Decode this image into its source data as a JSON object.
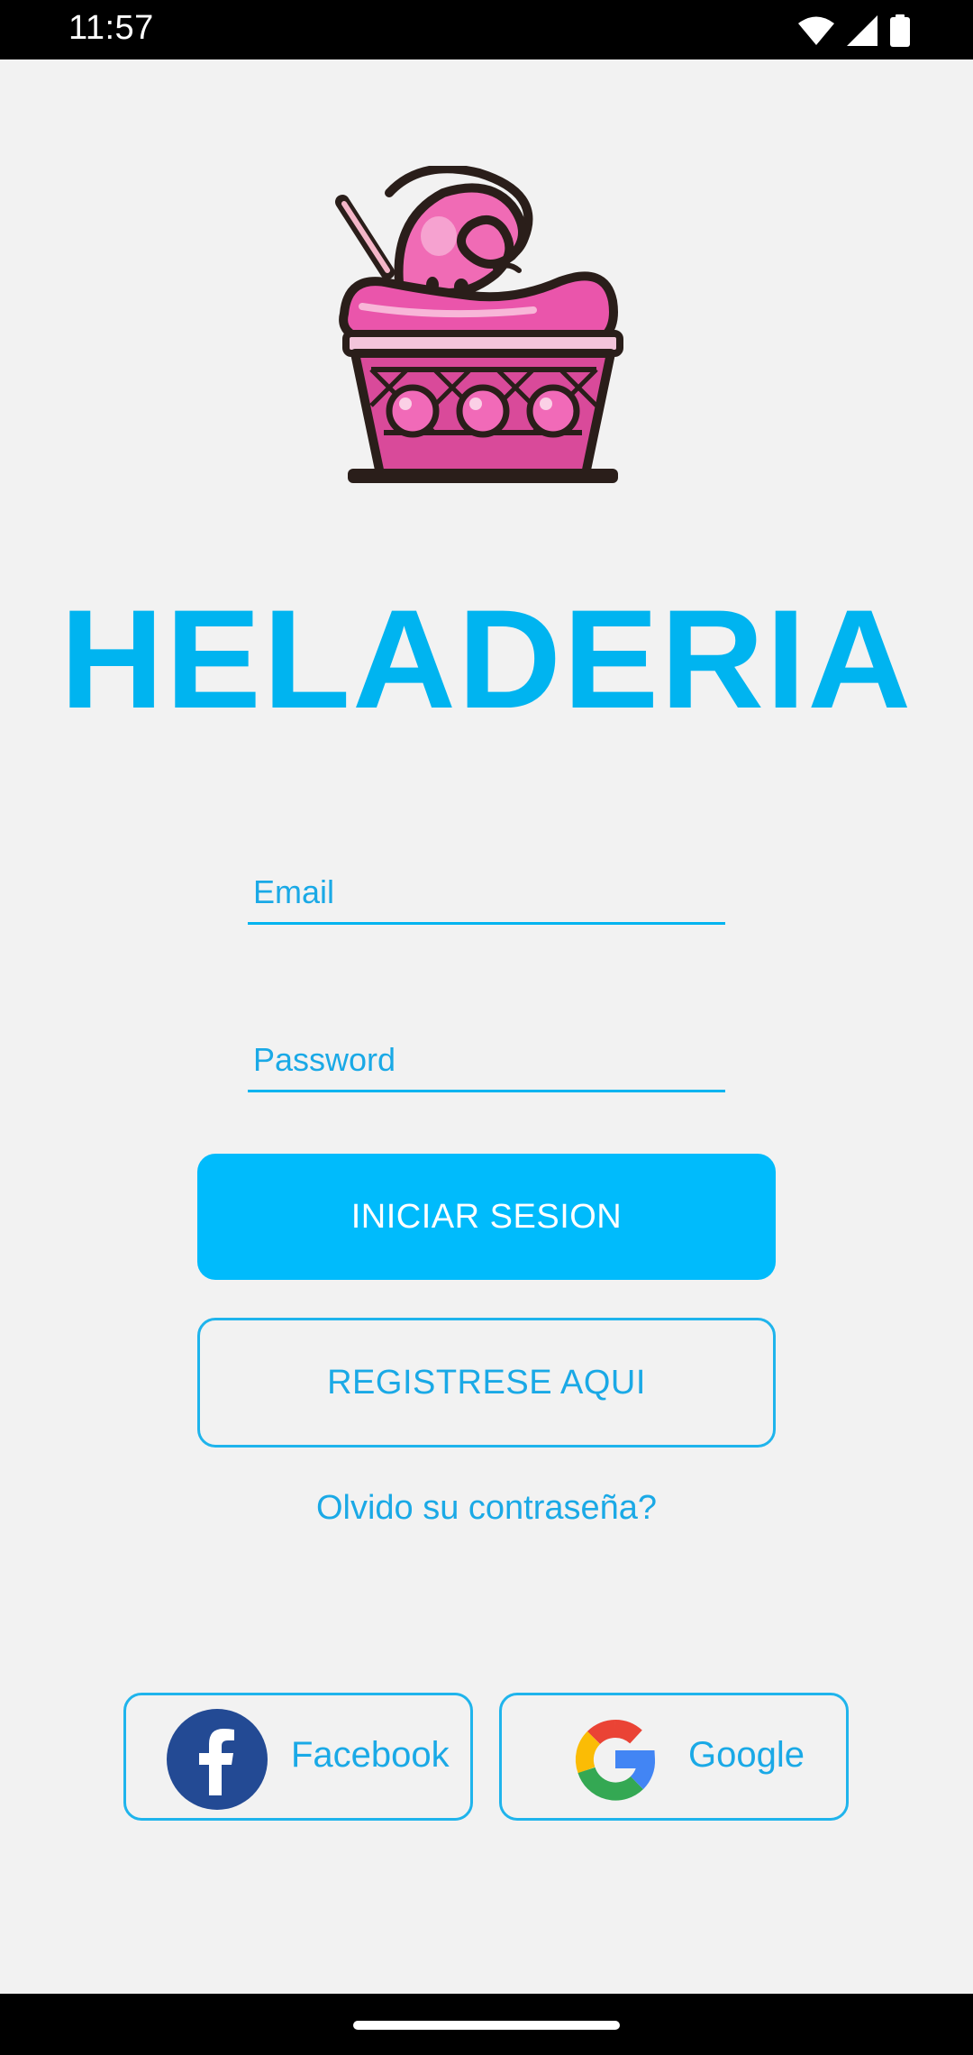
{
  "status_bar": {
    "time": "11:57",
    "icons": [
      "wifi-icon",
      "signal-icon",
      "battery-icon"
    ]
  },
  "app": {
    "logo_icon": "ice-cream-cup-logo",
    "title": "HELADERIA",
    "accent_color": "#00b4f0"
  },
  "login": {
    "email_placeholder": "Email",
    "email_value": "",
    "password_placeholder": "Password",
    "password_value": "",
    "login_label": "INICIAR SESION",
    "register_label": "REGISTRESE AQUI",
    "forgot_label": "Olvido su contraseña?"
  },
  "social": {
    "facebook_label": "Facebook",
    "google_label": "Google"
  }
}
